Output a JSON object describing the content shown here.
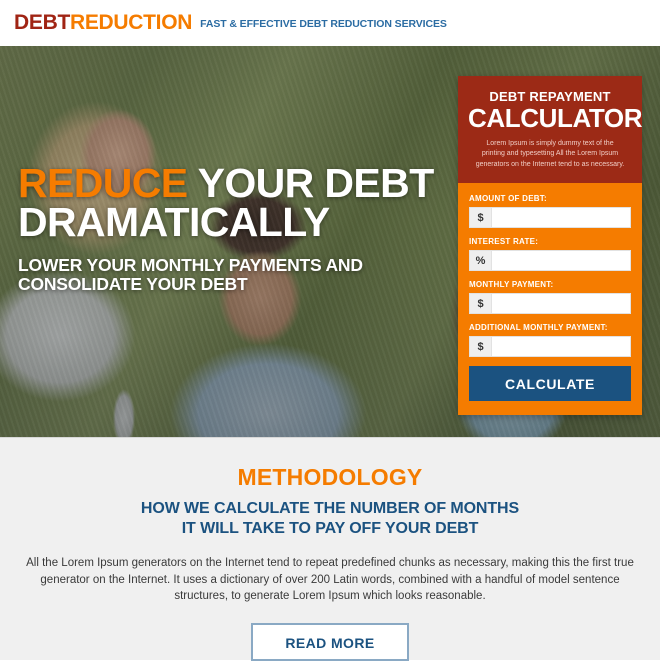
{
  "header": {
    "logo_primary": "DEBT",
    "logo_secondary": "REDUCTION",
    "tagline": "FAST & EFFECTIVE DEBT REDUCTION SERVICES"
  },
  "hero": {
    "headline_accent": "REDUCE",
    "headline_rest": " YOUR DEBT",
    "headline_line2": "DRAMATICALLY",
    "subheadline_line1": "LOWER YOUR MONTHLY PAYMENTS AND",
    "subheadline_line2": "CONSOLIDATE YOUR DEBT"
  },
  "calculator": {
    "eyebrow": "DEBT REPAYMENT",
    "title": "CALCULATOR",
    "description": "Lorem Ipsum is simply dummy text of the printing and typesetting All the Lorem Ipsum generators on the Internet tend to as necessary.",
    "fields": [
      {
        "label": "AMOUNT OF DEBT:",
        "prefix": "$",
        "value": "",
        "placeholder": ""
      },
      {
        "label": "INTEREST RATE:",
        "prefix": "%",
        "value": "",
        "placeholder": ""
      },
      {
        "label": "MONTHLY PAYMENT:",
        "prefix": "$",
        "value": "",
        "placeholder": ""
      },
      {
        "label": "ADDITIONAL MONTHLY PAYMENT:",
        "prefix": "$",
        "value": "",
        "placeholder": ""
      }
    ],
    "submit_label": "CALCULATE"
  },
  "methodology": {
    "title": "METHODOLOGY",
    "subtitle_line1": "HOW WE CALCULATE THE NUMBER OF MONTHS",
    "subtitle_line2": "IT WILL TAKE TO PAY OFF YOUR DEBT",
    "body": "All the Lorem Ipsum generators on the Internet tend to repeat predefined chunks as necessary, making this the first true generator on the Internet. It uses a dictionary of over 200 Latin words, combined with a handful of model sentence structures, to generate Lorem Ipsum which looks reasonable.",
    "read_more_label": "READ MORE"
  },
  "colors": {
    "brand_orange": "#f57c00",
    "brand_maroon": "#a02414",
    "calc_header_red": "#9c2a16",
    "brand_blue": "#1b5280",
    "tagline_blue": "#2b6ca3",
    "section_bg": "#f0f0f0"
  }
}
